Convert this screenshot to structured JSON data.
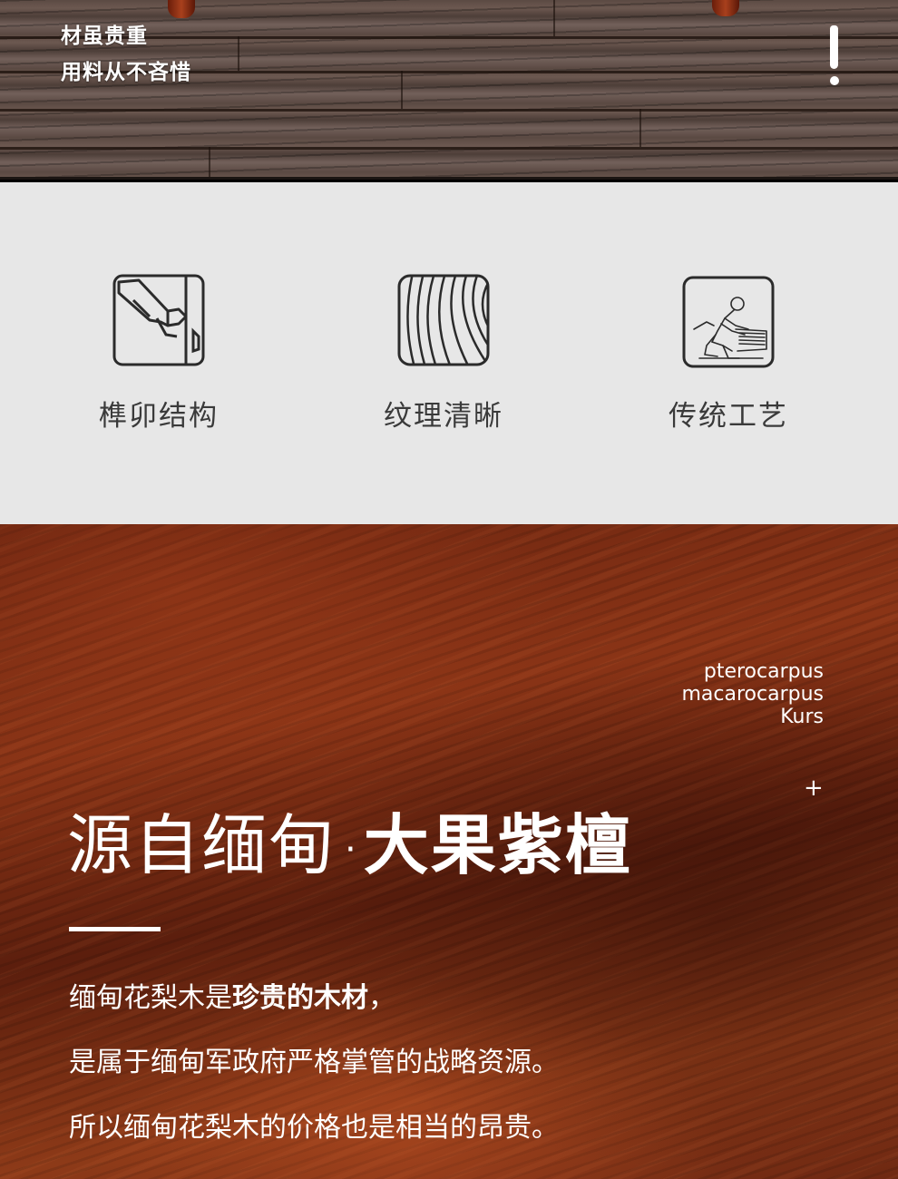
{
  "top_banner": {
    "line1": "材虽贵重",
    "line2": "用料从不吝惜"
  },
  "features": [
    {
      "icon": "mortise-tenon-icon",
      "label": "榫卯结构"
    },
    {
      "icon": "wood-grain-icon",
      "label": "纹理清晰"
    },
    {
      "icon": "craftsman-icon",
      "label": "传统工艺"
    }
  ],
  "wood_section": {
    "latin_line1": "pterocarpus",
    "latin_line2": "macarocarpus",
    "latin_line3": "Kurs",
    "plus": "+",
    "title_light": "源自缅甸",
    "title_sep": "·",
    "title_bold": "大果紫檀",
    "para1_normal": "缅甸花梨木是",
    "para1_bold": "珍贵的木材",
    "para1_tail": "，",
    "para2": "是属于缅甸军政府严格掌管的战略资源。",
    "para3": "所以缅甸花梨木的价格也是相当的昂贵。"
  },
  "colors": {
    "feature_bg": "#e7e7e7",
    "feature_text": "#3a3a3a",
    "wood_accent": "#8a3416"
  }
}
